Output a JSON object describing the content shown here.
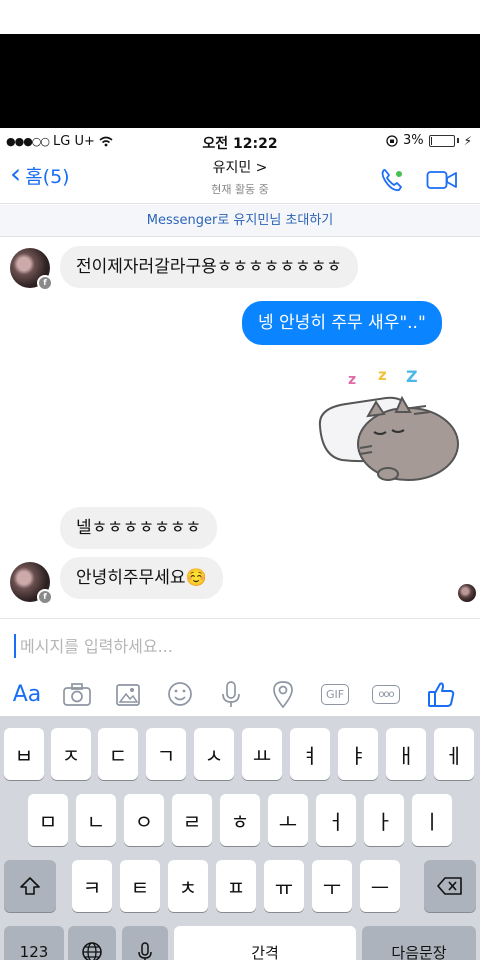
{
  "status_bar": {
    "signal_dots": "●●●○○",
    "carrier": "LG U+",
    "time": "오전 12:22",
    "battery_percent": "3%",
    "battery_level": 0.03
  },
  "header": {
    "back_label": "홈(5)",
    "contact_name": "유지민 >",
    "contact_status": "현재 활동 중",
    "icons": [
      "phone-icon",
      "video-icon"
    ]
  },
  "invite_banner": "Messenger로 유지민님 초대하기",
  "messages": [
    {
      "id": "m1",
      "direction": "in",
      "text": "전이제자러갈라구용ㅎㅎㅎㅎㅎㅎㅎㅎ"
    },
    {
      "id": "m2",
      "direction": "out",
      "text": "넹 안녕히 주무 새우\"..\""
    },
    {
      "id": "m3",
      "direction": "out",
      "type": "sticker",
      "sticker": "sleeping-cat-sticker",
      "zzz": "z z Z"
    },
    {
      "id": "m4",
      "direction": "in",
      "text": "넬ㅎㅎㅎㅎㅎㅎㅎ"
    },
    {
      "id": "m5",
      "direction": "in",
      "text": "안녕히주무세요☺️"
    }
  ],
  "composer": {
    "placeholder": "메시지를 입력하세요...",
    "value": ""
  },
  "toolbar": {
    "aa_label": "Aa",
    "gif_label": "GIF",
    "more_label": "ooo",
    "icons": [
      "camera-icon",
      "gallery-icon",
      "emoji-icon",
      "microphone-icon",
      "location-icon",
      "gif-icon",
      "more-icon",
      "thumbs-up-icon"
    ]
  },
  "keyboard": {
    "row1": [
      "ㅂ",
      "ㅈ",
      "ㄷ",
      "ㄱ",
      "ㅅ",
      "ㅛ",
      "ㅕ",
      "ㅑ",
      "ㅐ",
      "ㅔ"
    ],
    "row2": [
      "ㅁ",
      "ㄴ",
      "ㅇ",
      "ㄹ",
      "ㅎ",
      "ㅗ",
      "ㅓ",
      "ㅏ",
      "ㅣ"
    ],
    "row3": [
      "ㅋ",
      "ㅌ",
      "ㅊ",
      "ㅍ",
      "ㅠ",
      "ㅜ",
      "ㅡ"
    ],
    "numbers_label": "123",
    "space_label": "간격",
    "return_label": "다음문장"
  }
}
